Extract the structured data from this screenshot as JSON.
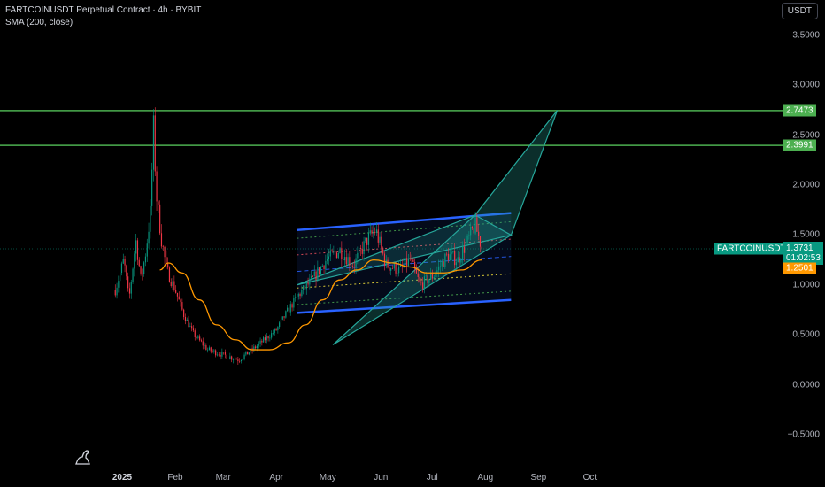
{
  "header": {
    "symbol_line": "FARTCOINUSDT Perpetual Contract · 4h · BYBIT",
    "indicator_line": "SMA (200, close)"
  },
  "toolbar": {
    "currency_label": "USDT"
  },
  "price_axis": {
    "ticks": [
      "3.5000",
      "3.0000",
      "2.5000",
      "2.0000",
      "1.5000",
      "1.0000",
      "0.5000",
      "0.0000",
      "−0.5000"
    ],
    "tick_values": [
      3.5,
      3.0,
      2.5,
      2.0,
      1.5,
      1.0,
      0.5,
      0.0,
      -0.5
    ]
  },
  "time_axis": {
    "labels": [
      "2025",
      "Feb",
      "Mar",
      "Apr",
      "May",
      "Jun",
      "Jul",
      "Aug",
      "Sep",
      "Oct"
    ],
    "bold_label": "2025"
  },
  "tags": {
    "resistance_high": "2.7473",
    "resistance_low": "2.3991",
    "symbol": "FARTCOINUSDT.P",
    "last_price": "1.3731",
    "countdown": "01:02:53",
    "sma_value": "1.2501"
  },
  "colors": {
    "background": "#000000",
    "up": "#089981",
    "down": "#f23645",
    "sma": "#ff9800",
    "resistance": "#4caf50",
    "channel": "#2962ff",
    "wedge": "#26a69a"
  },
  "icons": {
    "logo": "tradingview-dino-icon"
  },
  "chart_data": {
    "type": "candlestick",
    "title": "",
    "ylim": [
      -0.65,
      3.8
    ],
    "yticks": [
      3.5,
      3.0,
      2.5,
      2.0,
      1.5,
      1.0,
      0.5,
      0.0,
      -0.5
    ],
    "x_months": [
      "2025",
      "Feb",
      "Mar",
      "Apr",
      "May",
      "Jun",
      "Jul",
      "Aug",
      "Sep",
      "Oct"
    ],
    "resistance_levels": [
      2.7473,
      2.3991
    ],
    "last_price": 1.3731,
    "sma200_last": 1.2501,
    "price_path": [
      [
        "2024-12-28",
        0.95
      ],
      [
        "2025-01-02",
        1.25
      ],
      [
        "2025-01-05",
        0.85
      ],
      [
        "2025-01-09",
        1.45
      ],
      [
        "2025-01-12",
        1.05
      ],
      [
        "2025-01-15",
        1.35
      ],
      [
        "2025-01-18",
        1.8
      ],
      [
        "2025-01-19",
        2.7
      ],
      [
        "2025-01-21",
        1.9
      ],
      [
        "2025-01-24",
        1.45
      ],
      [
        "2025-01-27",
        1.15
      ],
      [
        "2025-02-01",
        0.95
      ],
      [
        "2025-02-06",
        0.7
      ],
      [
        "2025-02-12",
        0.5
      ],
      [
        "2025-02-20",
        0.35
      ],
      [
        "2025-03-01",
        0.3
      ],
      [
        "2025-03-10",
        0.25
      ],
      [
        "2025-03-18",
        0.35
      ],
      [
        "2025-03-25",
        0.45
      ],
      [
        "2025-04-01",
        0.55
      ],
      [
        "2025-04-08",
        0.75
      ],
      [
        "2025-04-14",
        0.9
      ],
      [
        "2025-04-22",
        1.05
      ],
      [
        "2025-04-30",
        1.25
      ],
      [
        "2025-05-08",
        1.35
      ],
      [
        "2025-05-16",
        1.2
      ],
      [
        "2025-05-24",
        1.45
      ],
      [
        "2025-05-29",
        1.55
      ],
      [
        "2025-06-04",
        1.2
      ],
      [
        "2025-06-12",
        1.15
      ],
      [
        "2025-06-18",
        1.25
      ],
      [
        "2025-06-24",
        1.0
      ],
      [
        "2025-07-02",
        1.1
      ],
      [
        "2025-07-10",
        1.3
      ],
      [
        "2025-07-16",
        1.25
      ],
      [
        "2025-07-22",
        1.45
      ],
      [
        "2025-07-26",
        1.6
      ],
      [
        "2025-07-30",
        1.37
      ]
    ],
    "sma200_path": [
      [
        "2025-01-23",
        1.15
      ],
      [
        "2025-01-28",
        1.22
      ],
      [
        "2025-02-05",
        1.12
      ],
      [
        "2025-02-15",
        0.85
      ],
      [
        "2025-02-25",
        0.6
      ],
      [
        "2025-03-08",
        0.45
      ],
      [
        "2025-03-18",
        0.35
      ],
      [
        "2025-03-28",
        0.35
      ],
      [
        "2025-04-08",
        0.42
      ],
      [
        "2025-04-18",
        0.6
      ],
      [
        "2025-04-28",
        0.85
      ],
      [
        "2025-05-08",
        1.05
      ],
      [
        "2025-05-18",
        1.15
      ],
      [
        "2025-05-28",
        1.25
      ],
      [
        "2025-06-08",
        1.22
      ],
      [
        "2025-06-18",
        1.18
      ],
      [
        "2025-06-28",
        1.12
      ],
      [
        "2025-07-08",
        1.12
      ],
      [
        "2025-07-18",
        1.15
      ],
      [
        "2025-07-30",
        1.25
      ]
    ],
    "channel": {
      "upper": [
        [
          "2025-04-13",
          1.55
        ],
        [
          "2025-08-16",
          1.72
        ]
      ],
      "lower": [
        [
          "2025-04-13",
          0.72
        ],
        [
          "2025-08-16",
          0.85
        ]
      ],
      "levels": [
        0.1,
        0.3,
        0.5,
        0.7,
        0.9
      ]
    },
    "wedge_1": [
      [
        "2025-04-13",
        1.0
      ],
      [
        "2025-07-26",
        1.7
      ],
      [
        "2025-08-16",
        1.5
      ]
    ],
    "wedge_2": [
      [
        "2025-05-04",
        0.4
      ],
      [
        "2025-07-26",
        1.7
      ],
      [
        "2025-09-12",
        2.75
      ],
      [
        "2025-08-16",
        1.5
      ]
    ]
  }
}
